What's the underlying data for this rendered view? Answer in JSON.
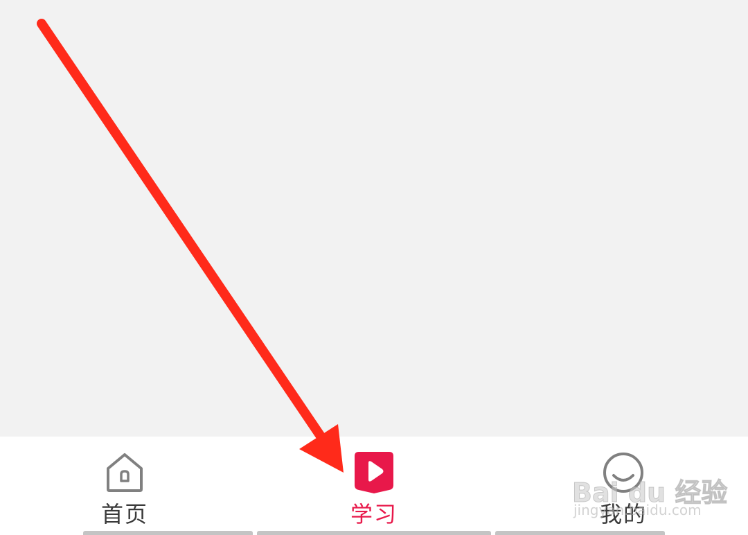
{
  "tabbar": {
    "items": [
      {
        "label": "首页",
        "icon": "home-icon",
        "active": false
      },
      {
        "label": "学习",
        "icon": "play-video-icon",
        "active": true
      },
      {
        "label": "我的",
        "icon": "smiley-profile-icon",
        "active": false
      }
    ]
  },
  "watermark": {
    "brand": "Bai du 经验",
    "url": "jingyan.baidu.com"
  },
  "colors": {
    "background": "#f2f2f2",
    "tabbar_bg": "#ffffff",
    "active": "#e8184a",
    "inactive_text": "#3a3a3a",
    "inactive_icon": "#808080",
    "annotation_arrow": "#ff2a1a"
  }
}
